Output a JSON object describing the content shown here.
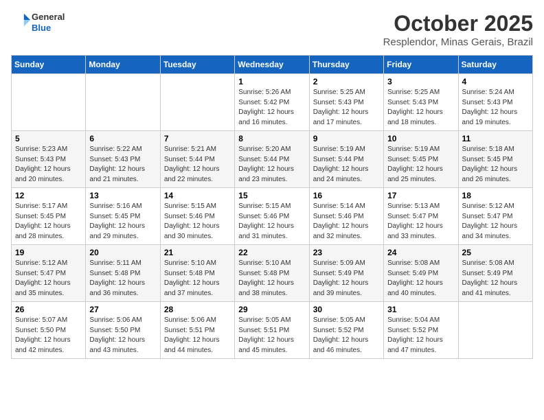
{
  "header": {
    "logo_line1": "General",
    "logo_line2": "Blue",
    "month_title": "October 2025",
    "location": "Resplendor, Minas Gerais, Brazil"
  },
  "weekdays": [
    "Sunday",
    "Monday",
    "Tuesday",
    "Wednesday",
    "Thursday",
    "Friday",
    "Saturday"
  ],
  "weeks": [
    [
      {
        "day": "",
        "info": ""
      },
      {
        "day": "",
        "info": ""
      },
      {
        "day": "",
        "info": ""
      },
      {
        "day": "1",
        "info": "Sunrise: 5:26 AM\nSunset: 5:42 PM\nDaylight: 12 hours\nand 16 minutes."
      },
      {
        "day": "2",
        "info": "Sunrise: 5:25 AM\nSunset: 5:43 PM\nDaylight: 12 hours\nand 17 minutes."
      },
      {
        "day": "3",
        "info": "Sunrise: 5:25 AM\nSunset: 5:43 PM\nDaylight: 12 hours\nand 18 minutes."
      },
      {
        "day": "4",
        "info": "Sunrise: 5:24 AM\nSunset: 5:43 PM\nDaylight: 12 hours\nand 19 minutes."
      }
    ],
    [
      {
        "day": "5",
        "info": "Sunrise: 5:23 AM\nSunset: 5:43 PM\nDaylight: 12 hours\nand 20 minutes."
      },
      {
        "day": "6",
        "info": "Sunrise: 5:22 AM\nSunset: 5:43 PM\nDaylight: 12 hours\nand 21 minutes."
      },
      {
        "day": "7",
        "info": "Sunrise: 5:21 AM\nSunset: 5:44 PM\nDaylight: 12 hours\nand 22 minutes."
      },
      {
        "day": "8",
        "info": "Sunrise: 5:20 AM\nSunset: 5:44 PM\nDaylight: 12 hours\nand 23 minutes."
      },
      {
        "day": "9",
        "info": "Sunrise: 5:19 AM\nSunset: 5:44 PM\nDaylight: 12 hours\nand 24 minutes."
      },
      {
        "day": "10",
        "info": "Sunrise: 5:19 AM\nSunset: 5:45 PM\nDaylight: 12 hours\nand 25 minutes."
      },
      {
        "day": "11",
        "info": "Sunrise: 5:18 AM\nSunset: 5:45 PM\nDaylight: 12 hours\nand 26 minutes."
      }
    ],
    [
      {
        "day": "12",
        "info": "Sunrise: 5:17 AM\nSunset: 5:45 PM\nDaylight: 12 hours\nand 28 minutes."
      },
      {
        "day": "13",
        "info": "Sunrise: 5:16 AM\nSunset: 5:45 PM\nDaylight: 12 hours\nand 29 minutes."
      },
      {
        "day": "14",
        "info": "Sunrise: 5:15 AM\nSunset: 5:46 PM\nDaylight: 12 hours\nand 30 minutes."
      },
      {
        "day": "15",
        "info": "Sunrise: 5:15 AM\nSunset: 5:46 PM\nDaylight: 12 hours\nand 31 minutes."
      },
      {
        "day": "16",
        "info": "Sunrise: 5:14 AM\nSunset: 5:46 PM\nDaylight: 12 hours\nand 32 minutes."
      },
      {
        "day": "17",
        "info": "Sunrise: 5:13 AM\nSunset: 5:47 PM\nDaylight: 12 hours\nand 33 minutes."
      },
      {
        "day": "18",
        "info": "Sunrise: 5:12 AM\nSunset: 5:47 PM\nDaylight: 12 hours\nand 34 minutes."
      }
    ],
    [
      {
        "day": "19",
        "info": "Sunrise: 5:12 AM\nSunset: 5:47 PM\nDaylight: 12 hours\nand 35 minutes."
      },
      {
        "day": "20",
        "info": "Sunrise: 5:11 AM\nSunset: 5:48 PM\nDaylight: 12 hours\nand 36 minutes."
      },
      {
        "day": "21",
        "info": "Sunrise: 5:10 AM\nSunset: 5:48 PM\nDaylight: 12 hours\nand 37 minutes."
      },
      {
        "day": "22",
        "info": "Sunrise: 5:10 AM\nSunset: 5:48 PM\nDaylight: 12 hours\nand 38 minutes."
      },
      {
        "day": "23",
        "info": "Sunrise: 5:09 AM\nSunset: 5:49 PM\nDaylight: 12 hours\nand 39 minutes."
      },
      {
        "day": "24",
        "info": "Sunrise: 5:08 AM\nSunset: 5:49 PM\nDaylight: 12 hours\nand 40 minutes."
      },
      {
        "day": "25",
        "info": "Sunrise: 5:08 AM\nSunset: 5:49 PM\nDaylight: 12 hours\nand 41 minutes."
      }
    ],
    [
      {
        "day": "26",
        "info": "Sunrise: 5:07 AM\nSunset: 5:50 PM\nDaylight: 12 hours\nand 42 minutes."
      },
      {
        "day": "27",
        "info": "Sunrise: 5:06 AM\nSunset: 5:50 PM\nDaylight: 12 hours\nand 43 minutes."
      },
      {
        "day": "28",
        "info": "Sunrise: 5:06 AM\nSunset: 5:51 PM\nDaylight: 12 hours\nand 44 minutes."
      },
      {
        "day": "29",
        "info": "Sunrise: 5:05 AM\nSunset: 5:51 PM\nDaylight: 12 hours\nand 45 minutes."
      },
      {
        "day": "30",
        "info": "Sunrise: 5:05 AM\nSunset: 5:52 PM\nDaylight: 12 hours\nand 46 minutes."
      },
      {
        "day": "31",
        "info": "Sunrise: 5:04 AM\nSunset: 5:52 PM\nDaylight: 12 hours\nand 47 minutes."
      },
      {
        "day": "",
        "info": ""
      }
    ]
  ]
}
